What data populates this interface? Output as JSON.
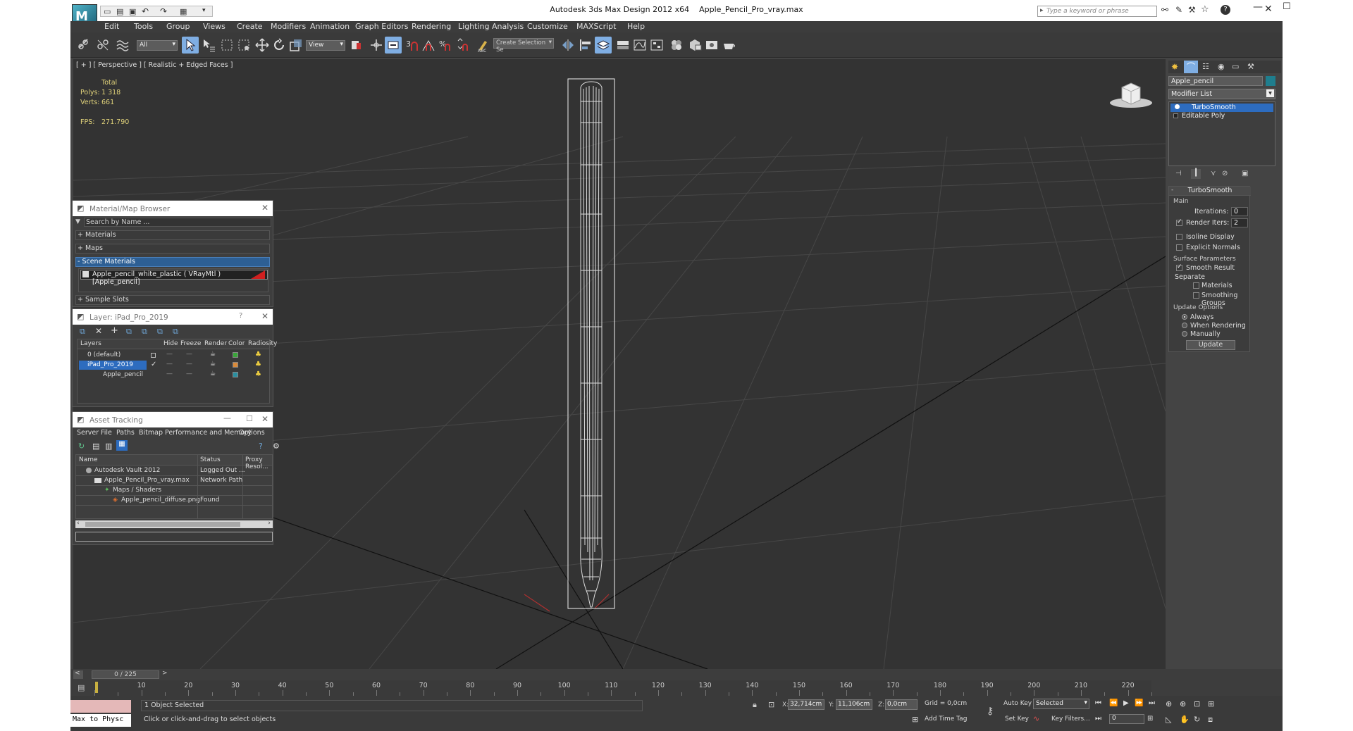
{
  "titlebar": {
    "app": "Autodesk 3ds Max Design 2012 x64",
    "file": "Apple_Pencil_Pro_vray.max",
    "search_placeholder": "Type a keyword or phrase"
  },
  "menu": [
    "Edit",
    "Tools",
    "Group",
    "Views",
    "Create",
    "Modifiers",
    "Animation",
    "Graph Editors",
    "Rendering",
    "Lighting Analysis",
    "Customize",
    "MAXScript",
    "Help"
  ],
  "toolbar": {
    "selection_filter": "All",
    "ref_coord": "View",
    "named_selection": "Create Selection Se"
  },
  "viewport": {
    "label": "[ + ] [ Perspective ] [ Realistic + Edged Faces ]",
    "stats": {
      "total_label": "Total",
      "polys_label": "Polys:",
      "polys": "1 318",
      "verts_label": "Verts:",
      "verts": "661",
      "fps_label": "FPS:",
      "fps": "271.790"
    }
  },
  "material_browser": {
    "title": "Material/Map Browser",
    "search_placeholder": "Search by Name ...",
    "groups": [
      "+ Materials",
      "+ Maps",
      "- Scene Materials"
    ],
    "scene_item": "Apple_pencil_white_plastic ( VRayMtl ) [Apple_pencil]",
    "sample_slots": "+ Sample Slots"
  },
  "layer_dialog": {
    "title": "Layer: iPad_Pro_2019",
    "help": "?",
    "columns": [
      "Layers",
      "Hide",
      "Freeze",
      "Render",
      "Color",
      "Radiosity"
    ],
    "rows": [
      {
        "name": "0 (default)",
        "color": "#3aa63a"
      },
      {
        "name": "iPad_Pro_2019",
        "color": "#d98a3a"
      },
      {
        "name": "Apple_pencil",
        "color": "#2a8fa0"
      }
    ]
  },
  "asset_tracking": {
    "title": "Asset Tracking",
    "menu": [
      "Server",
      "File",
      "Paths",
      "Bitmap Performance and Memory",
      "Options"
    ],
    "columns": [
      "Name",
      "Status",
      "Proxy Resol..."
    ],
    "rows": [
      {
        "name": "Autodesk Vault 2012",
        "status": "Logged Out ..."
      },
      {
        "name": "Apple_Pencil_Pro_vray.max",
        "status": "Network Path"
      },
      {
        "name": "Maps / Shaders",
        "status": ""
      },
      {
        "name": "Apple_pencil_diffuse.png",
        "status": "Found"
      }
    ]
  },
  "command_panel": {
    "object_name": "Apple_pencil",
    "modifier_list": "Modifier List",
    "stack": [
      "TurboSmooth",
      "Editable Poly"
    ],
    "turbosmooth": {
      "title": "TurboSmooth",
      "main": "Main",
      "iterations_label": "Iterations:",
      "iterations": "0",
      "render_iters_label": "Render Iters:",
      "render_iters": "2",
      "isoline": "Isoline Display",
      "explicit": "Explicit Normals",
      "surface": "Surface Parameters",
      "smooth_result": "Smooth Result",
      "separate": "Separate",
      "materials": "Materials",
      "smoothing": "Smoothing Groups",
      "update_options": "Update Options",
      "always": "Always",
      "when_rendering": "When Rendering",
      "manually": "Manually",
      "update": "Update"
    }
  },
  "timeline": {
    "frame_display": "0 / 225",
    "ticks": [
      "10",
      "20",
      "30",
      "40",
      "50",
      "60",
      "70",
      "80",
      "90",
      "100",
      "110",
      "120",
      "130",
      "140",
      "150",
      "160",
      "170",
      "180",
      "190",
      "200",
      "210",
      "220"
    ],
    "tick_values": [
      10,
      20,
      30,
      40,
      50,
      60,
      70,
      80,
      90,
      100,
      110,
      120,
      130,
      140,
      150,
      160,
      170,
      180,
      190,
      200,
      210,
      220
    ]
  },
  "status": {
    "maxscript": "Max to Physc",
    "selected": "1 Object Selected",
    "prompt": "Click or click-and-drag to select objects",
    "x_label": "X:",
    "x": "32,714cm",
    "y_label": "Y:",
    "y": "11,106cm",
    "z_label": "Z:",
    "z": "0,0cm",
    "grid": "Grid = 0,0cm",
    "auto_key": "Auto Key",
    "auto_key_sel": "Selected",
    "set_key": "Set Key",
    "key_filters": "Key Filters...",
    "add_time_tag": "Add Time Tag",
    "frame": "0"
  }
}
